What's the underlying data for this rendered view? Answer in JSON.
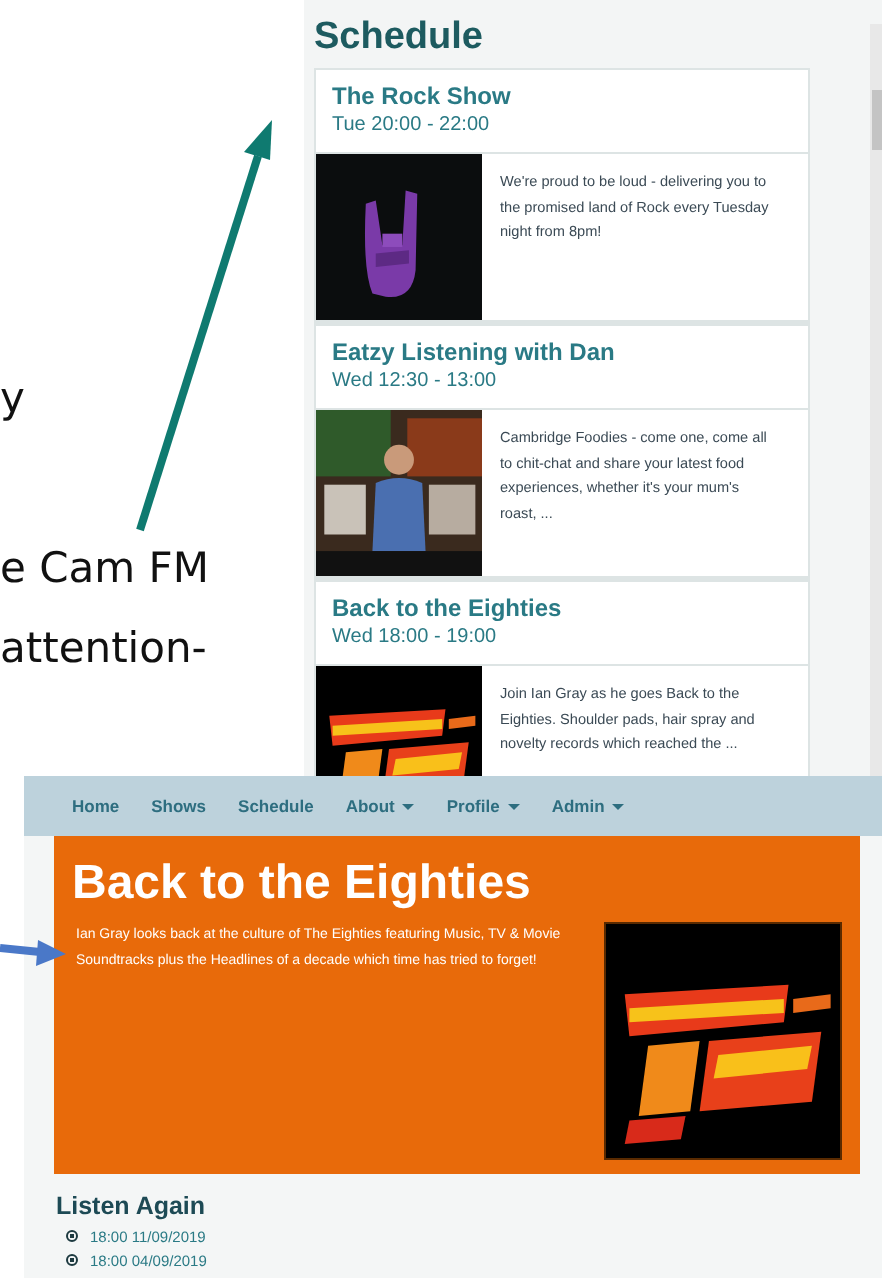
{
  "slide_text": [
    "y",
    "e Cam FM",
    "attention-"
  ],
  "schedule": {
    "title": "Schedule",
    "shows": [
      {
        "title": "The Rock Show",
        "time": "Tue 20:00 - 22:00",
        "description": "We're proud to be loud - delivering you to the promised land of Rock every Tuesday night from 8pm!"
      },
      {
        "title": "Eatzy Listening with Dan",
        "time": "Wed 12:30 - 13:00",
        "description": "Cambridge Foodies - come one, come all to chit-chat and share your latest food experiences, whether it's your mum's roast, ..."
      },
      {
        "title": "Back to the Eighties",
        "time": "Wed 18:00 - 19:00",
        "description": "Join Ian Gray as he goes Back to the Eighties. Shoulder pads, hair spray and novelty records which reached the ..."
      }
    ]
  },
  "show_page": {
    "nav": [
      {
        "label": "Home",
        "dropdown": false
      },
      {
        "label": "Shows",
        "dropdown": false
      },
      {
        "label": "Schedule",
        "dropdown": false
      },
      {
        "label": "About",
        "dropdown": true
      },
      {
        "label": "Profile",
        "dropdown": true
      },
      {
        "label": "Admin",
        "dropdown": true
      }
    ],
    "title": "Back to the Eighties",
    "description": "Ian Gray looks back at the culture of The Eighties featuring Music, TV & Movie Soundtracks plus the Headlines of a decade which time has tried to forget!",
    "listen_again": {
      "title": "Listen Again",
      "items": [
        "18:00 11/09/2019",
        "18:00 04/09/2019"
      ]
    }
  }
}
